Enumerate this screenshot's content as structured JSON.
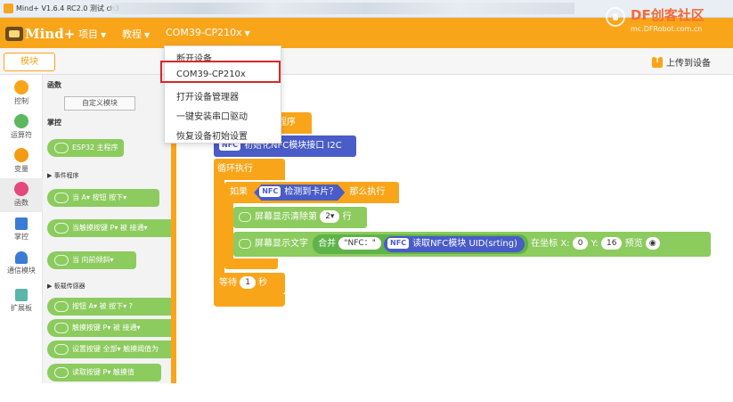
{
  "window": {
    "title": "Mind+ V1.6.4 RC2.0  测试 ch3"
  },
  "watermark": {
    "title": "DF创客社区",
    "subtitle": "mc.DFRobot.com.cn"
  },
  "menubar": {
    "logo": "Mind+",
    "project": "项目",
    "tutorial": "教程",
    "device": "COM39-CP210x"
  },
  "toolbar": {
    "modules_tab": "模块",
    "upload": "上传到设备"
  },
  "categories": [
    {
      "label": "控制",
      "color": "#f9a51a"
    },
    {
      "label": "运算符",
      "color": "#5cb85c"
    },
    {
      "label": "变量",
      "color": "#f39c12"
    },
    {
      "label": "函数",
      "color": "#e5487a"
    },
    {
      "label": "掌控",
      "color": "#3a7bd5"
    },
    {
      "label": "通信模块",
      "color": "#3a7bd5"
    },
    {
      "label": "扩展板",
      "color": "#5bb5a9"
    }
  ],
  "palette": {
    "functions_head": "函数",
    "custom_module": "自定义模块",
    "controller_head": "掌控",
    "main_program": "ESP32 主程序",
    "event_head": "事件程序",
    "blocks": [
      "当 A▾ 按钮 按下▾",
      "当触摸按键 P▾ 被 接通▾",
      "当 向前倾斜▾"
    ],
    "sensor_head": "板载传感器",
    "sensor_blocks": [
      "按钮 A▾ 被 按下▾ ?",
      "触摸按键 P▾ 被 接通▾",
      "设置按键 全部▾ 触摸阈值为",
      "读取按键 P▾ 触摸值"
    ]
  },
  "dropdown": {
    "items": [
      "断开设备",
      "COM39-CP210x",
      "打开设备管理器",
      "一键安装串口驱动",
      "恢复设备初始设置"
    ]
  },
  "workspace": {
    "program_label": "程序",
    "init_tag": "NFC",
    "init_text": "初始化NFC模块接口 I2C",
    "loop_label": "循环执行",
    "if_label": "如果",
    "if_tag": "NFC",
    "if_cond": "检测到卡片？",
    "then_label": "那么执行",
    "clear_text": "屏幕显示清除第",
    "clear_value": "2▾",
    "clear_suffix": "行",
    "show_text": "屏幕显示文字",
    "join_label": "合并",
    "join_string": "\"NFC：\"",
    "read_tag": "NFC",
    "read_text": "读取NFC模块 UID(srting)",
    "at_text": "在坐标 X:",
    "x_value": "0",
    "y_label": "Y:",
    "y_value": "16",
    "preview_label": "预览",
    "wait_label": "等待",
    "wait_value": "1",
    "wait_unit": "秒"
  }
}
